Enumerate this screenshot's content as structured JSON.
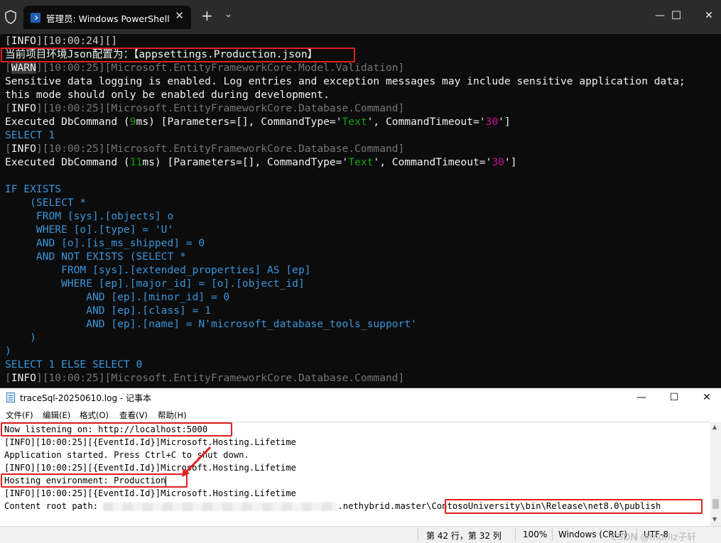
{
  "powershell": {
    "tab_title": "管理员: Windows PowerShell",
    "tab_close": "✕",
    "new_tab": "+",
    "dropdown": "⌄",
    "controls": {
      "minimize": "—",
      "maximize": "☐",
      "close": "✕"
    },
    "lines": {
      "l1": {
        "a": "[",
        "b": "INFO",
        "c": "][10:00:24][]"
      },
      "l2": "当前项目环境Json配置为：【appsettings.Production.json】",
      "l3": {
        "a": "[",
        "b": "WARN",
        "c": "][10:00:25][Microsoft.EntityFrameworkCore.Model.Validation]"
      },
      "l4": "Sensitive data logging is enabled. Log entries and exception messages may include sensitive application data;",
      "l5": "this mode should only be enabled during development.",
      "l6": {
        "a": "[",
        "b": "INFO",
        "c": "][10:00:25][Microsoft.EntityFrameworkCore.Database.Command]"
      },
      "l7": {
        "a": "Executed DbCommand (",
        "b": "9",
        "c": "ms) [Parameters=[], CommandType='",
        "d": "Text",
        "e": "', CommandTimeout='",
        "f": "30",
        "g": "']"
      },
      "l8": "SELECT 1",
      "l9": {
        "a": "[",
        "b": "INFO",
        "c": "][10:00:25][Microsoft.EntityFrameworkCore.Database.Command]"
      },
      "l10": {
        "a": "Executed DbCommand (",
        "b": "11",
        "c": "ms) [Parameters=[], CommandType='",
        "d": "Text",
        "e": "', CommandTimeout='",
        "f": "30",
        "g": "']"
      },
      "l12": "IF EXISTS",
      "l13": "    (SELECT *",
      "l14": "     FROM [sys].[objects] o",
      "l15": "     WHERE [o].[type] = 'U'",
      "l16": "     AND [o].[is_ms_shipped] = 0",
      "l17": "     AND NOT EXISTS (SELECT *",
      "l18": "         FROM [sys].[extended_properties] AS [ep]",
      "l19": "         WHERE [ep].[major_id] = [o].[object_id]",
      "l20": "             AND [ep].[minor_id] = 0",
      "l21": "             AND [ep].[class] = 1",
      "l22": "             AND [ep].[name] = N'microsoft_database_tools_support'",
      "l23": "    )",
      "l24": ")",
      "l25": "SELECT 1 ELSE SELECT 0",
      "l26": {
        "a": "[",
        "b": "INFO",
        "c": "][10:00:25][Microsoft.EntityFrameworkCore.Database.Command]"
      }
    }
  },
  "notepad": {
    "title": "traceSql-20250610.log - 记事本",
    "controls": {
      "minimize": "—",
      "maximize": "☐",
      "close": "✕"
    },
    "menu": [
      "文件(F)",
      "编辑(E)",
      "格式(O)",
      "查看(V)",
      "帮助(H)"
    ],
    "lines": {
      "n1": "Now listening on: http://localhost:5000",
      "n2": "[INFO][10:00:25][{EventId.Id}]Microsoft.Hosting.Lifetime",
      "n3": "Application started. Press Ctrl+C to shut down.",
      "n4": "[INFO][10:00:25][{EventId.Id}]Microsoft.Hosting.Lifetime",
      "n5": "Hosting environment: Production",
      "n6": "[INFO][10:00:25][{EventId.Id}]Microsoft.Hosting.Lifetime",
      "n7a": "Content root path: ",
      "n7b": ".nethybrid.master\\",
      "n7c": "ContosoUniversity\\bin\\Release\\net8.0\\publish"
    },
    "status": {
      "position": "第 42 行，第 32 列",
      "zoom": "100%",
      "line_ending": "Windows (CRLF)",
      "encoding": "UTF-8"
    },
    "watermark": "CSDN @morliz子轩"
  },
  "colors": {
    "highlight_box": "#e02020",
    "console_bg": "#0c0c0c",
    "info_label": "#f2f2f2"
  }
}
